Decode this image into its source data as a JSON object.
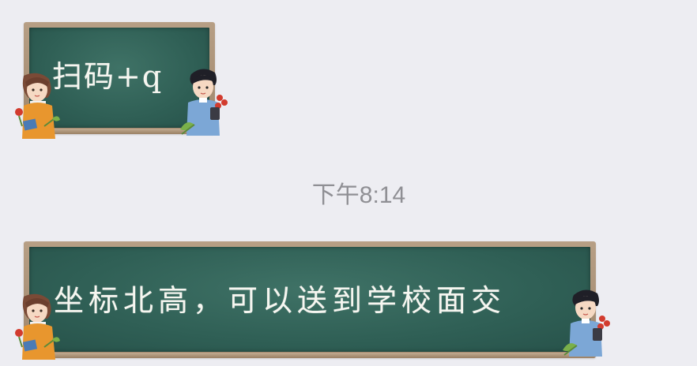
{
  "messages": [
    {
      "text": "扫码+q"
    },
    {
      "text": "坐标北高，可以送到学校面交"
    }
  ],
  "timestamp": "下午8:14",
  "colors": {
    "background": "#ededf2",
    "board": "#2f5f55",
    "frame": "#b79f85",
    "chalk": "#f6f6f0",
    "timestamp": "#8f8f94"
  },
  "icons": [
    "girl-student-sticker",
    "boy-student-sticker"
  ]
}
